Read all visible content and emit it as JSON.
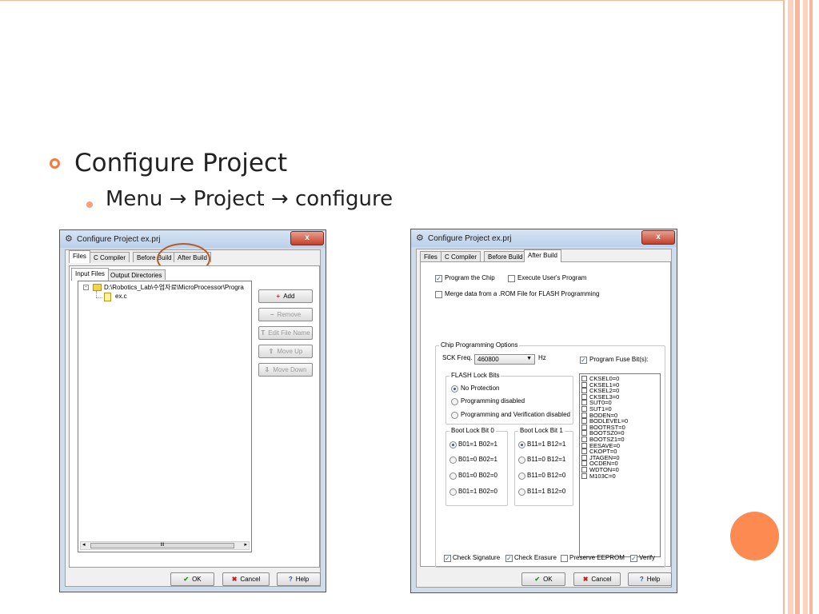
{
  "slide": {
    "heading": "Configure Project",
    "subheading": "Menu → Project → configure"
  },
  "colors": {
    "accent": "#f47c3c",
    "accent_light": "#f6b79a",
    "circle": "#fd8a51"
  },
  "left_dialog": {
    "title": "Configure Project ex.prj",
    "close_label": "x",
    "tabs": [
      "Files",
      "C Compiler",
      "Before Build",
      "After Build"
    ],
    "subtabs": [
      "Input Files",
      "Output Directories"
    ],
    "tree_root": "D:\\Robotics_Lab\\수업자료\\MicroProcessor\\Progra",
    "tree_child": "ex.c",
    "side_buttons": {
      "add": "Add",
      "remove": "Remove",
      "edit_file_name": "Edit File Name",
      "move_up": "Move Up",
      "move_down": "Move Down"
    },
    "scrollbar_grip": "III",
    "ok": "OK",
    "cancel": "Cancel",
    "help": "Help"
  },
  "right_dialog": {
    "title": "Configure Project ex.prj",
    "close_label": "x",
    "tabs": [
      "Files",
      "C Compiler",
      "Before Build",
      "After Build"
    ],
    "program_the_chip": "Program the Chip",
    "execute_users_program": "Execute User's Program",
    "merge_data": "Merge data from a .ROM File for FLASH Programming",
    "chip_programming_options": "Chip Programming Options",
    "sck_freq_label": "SCK Freq. :",
    "sck_freq_value": "460800",
    "hz": "Hz",
    "program_fuse_bits": "Program Fuse Bit(s):",
    "flash_lock_bits": "FLASH Lock Bits",
    "flash_options": [
      "No Protection",
      "Programming disabled",
      "Programming and Verification disabled"
    ],
    "boot_lock_bit0": "Boot Lock Bit 0",
    "boot0_options": [
      "B01=1 B02=1",
      "B01=0 B02=1",
      "B01=0 B02=0",
      "B01=1 B02=0"
    ],
    "boot_lock_bit1": "Boot Lock Bit 1",
    "boot1_options": [
      "B11=1 B12=1",
      "B11=0 B12=1",
      "B11=0 B12=0",
      "B11=1 B12=0"
    ],
    "fuse_bits": [
      "CKSEL0=0",
      "CKSEL1=0",
      "CKSEL2=0",
      "CKSEL3=0",
      "SUT0=0",
      "SUT1=0",
      "BODEN=0",
      "BODLEVEL=0",
      "BOOTRST=0",
      "BOOTSZ0=0",
      "BOOTSZ1=0",
      "EESAVE=0",
      "CKOPT=0",
      "JTAGEN=0",
      "OCDEN=0",
      "WDTON=0",
      "M103C=0"
    ],
    "check_signature": "Check Signature",
    "check_erasure": "Check Erasure",
    "preserve_eeprom": "Preserve EEPROM",
    "verify": "Verify",
    "ok": "OK",
    "cancel": "Cancel",
    "help": "Help"
  }
}
